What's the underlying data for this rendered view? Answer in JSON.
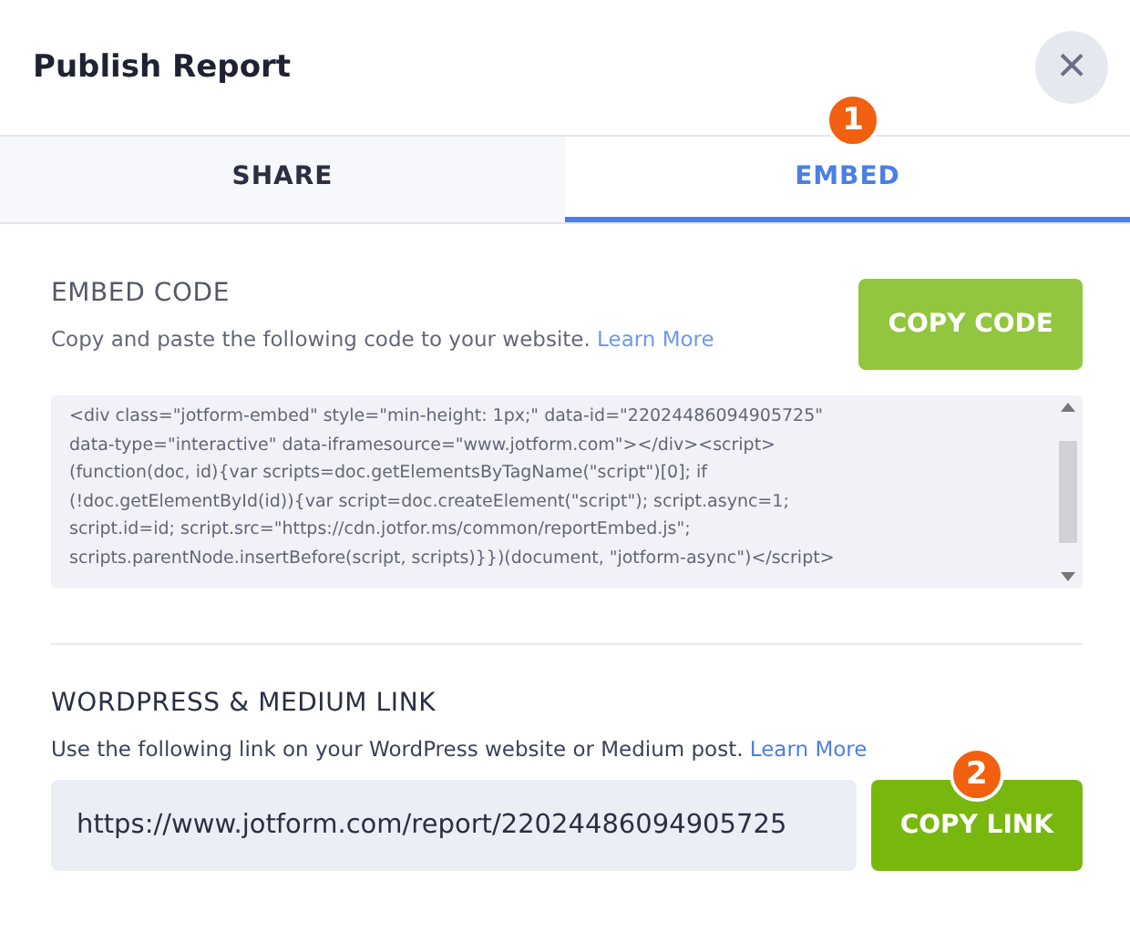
{
  "dialog": {
    "title": "Publish Report",
    "close": "×"
  },
  "tabs": [
    {
      "label": "SHARE",
      "selected": false
    },
    {
      "label": "EMBED",
      "selected": true,
      "badge": "1"
    }
  ],
  "embed": {
    "heading": "EMBED CODE",
    "description": "Copy and paste the following code to your website.",
    "link": "Learn More",
    "button": "COPY CODE",
    "code_lines": [
      "<div class=\"jotform-embed\" style=\"min-height: 1px;\" data-id=\"22024486094905725\"",
      "data-type=\"interactive\" data-iframesource=\"www.jotform.com\"></div><script>",
      "(function(doc, id){var scripts=doc.getElementsByTagName(\"script\")[0]; if",
      "(!doc.getElementById(id)){var script=doc.createElement(\"script\"); script.async=1;",
      "script.id=id; script.src=\"https://cdn.jotfor.ms/common/reportEmbed.js\";",
      "scripts.parentNode.insertBefore(script, scripts)}})(document, \"jotform-async\")</script>"
    ]
  },
  "wordpress": {
    "heading": "WORDPRESS & MEDIUM LINK",
    "description": "Use the following link on your WordPress website or Medium post.",
    "link": "Learn More",
    "url": "https://www.jotform.com/report/22024486094905725",
    "button": "COPY LINK",
    "badge": "2"
  }
}
